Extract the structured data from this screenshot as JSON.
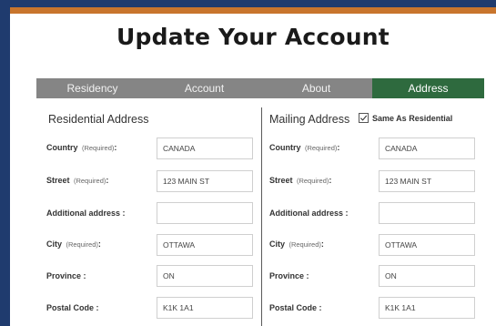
{
  "page": {
    "title": "Update Your Account"
  },
  "tabs": [
    {
      "label": "Residency",
      "active": false
    },
    {
      "label": "Account",
      "active": false
    },
    {
      "label": "About",
      "active": false
    },
    {
      "label": "Address",
      "active": true
    }
  ],
  "residential": {
    "section_title": "Residential Address",
    "fields": {
      "country": {
        "label": "Country",
        "required": "(Required)",
        "suffix": ":",
        "value": "CANADA"
      },
      "street": {
        "label": "Street",
        "required": "(Required)",
        "suffix": ":",
        "value": "123 MAIN ST"
      },
      "additional": {
        "label": "Additional address :",
        "value": ""
      },
      "city": {
        "label": "City",
        "required": "(Required)",
        "suffix": ":",
        "value": "OTTAWA"
      },
      "province": {
        "label": "Province :",
        "value": "ON"
      },
      "postal": {
        "label": "Postal Code :",
        "value": "K1K 1A1"
      }
    }
  },
  "mailing": {
    "section_title": "Mailing Address",
    "same_as_label": "Same As Residential",
    "same_as_checked": true,
    "fields": {
      "country": {
        "label": "Country",
        "required": "(Required)",
        "suffix": ":",
        "value": "CANADA"
      },
      "street": {
        "label": "Street",
        "required": "(Required)",
        "suffix": ":",
        "value": "123 MAIN ST"
      },
      "additional": {
        "label": "Additional address :",
        "value": ""
      },
      "city": {
        "label": "City",
        "required": "(Required)",
        "suffix": ":",
        "value": "OTTAWA"
      },
      "province": {
        "label": "Province :",
        "value": "ON"
      },
      "postal": {
        "label": "Postal Code :",
        "value": "K1K 1A1"
      }
    }
  },
  "colors": {
    "brand_navy": "#1f3b6e",
    "accent_orange": "#c8752d",
    "tab_inactive": "#858585",
    "tab_active": "#2e6a3e"
  }
}
